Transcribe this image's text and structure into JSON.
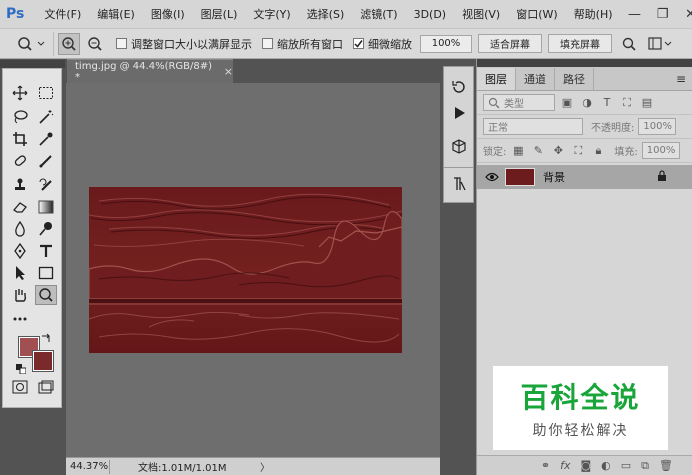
{
  "app": {
    "logo": "Ps"
  },
  "menu": {
    "items": [
      "文件(F)",
      "编辑(E)",
      "图像(I)",
      "图层(L)",
      "文字(Y)",
      "选择(S)",
      "滤镜(T)",
      "3D(D)",
      "视图(V)",
      "窗口(W)",
      "帮助(H)"
    ]
  },
  "window_controls": {
    "minimize": "—",
    "restore": "❐",
    "close": "✕"
  },
  "options": {
    "resize_window_label": "调整窗口大小以满屏显示",
    "resize_window_checked": false,
    "zoom_all_label": "缩放所有窗口",
    "zoom_all_checked": false,
    "scrubby_zoom_label": "细微缩放",
    "scrubby_zoom_checked": true,
    "zoom_value": "100%",
    "fit_screen_label": "适合屏幕",
    "fill_screen_label": "填充屏幕"
  },
  "colors": {
    "foreground": "#a05050",
    "background": "#7a2a2a",
    "image_base": "#6d1c1e"
  },
  "document": {
    "tab_title": "timg.jpg @ 44.4%(RGB/8#) *",
    "tab_close": "×"
  },
  "status": {
    "zoom": "44.37%",
    "doc_info": "文档:1.01M/1.01M",
    "arrow": "〉"
  },
  "layers_panel": {
    "tabs": [
      "图层",
      "通道",
      "路径"
    ],
    "filter_kind": "类型",
    "blend_mode": "正常",
    "opacity_label": "不透明度:",
    "opacity_value": "100%",
    "lock_label": "锁定:",
    "fill_label": "填充:",
    "fill_value": "100%",
    "layers": [
      {
        "name": "背景",
        "visible": true,
        "locked": true
      }
    ],
    "bottom_icons": [
      "link-icon",
      "fx-icon",
      "mask-icon",
      "adjustment-icon",
      "group-icon",
      "new-layer-icon",
      "delete-icon"
    ]
  },
  "watermark": {
    "main": "百科全说",
    "sub": "助你轻松解决"
  }
}
